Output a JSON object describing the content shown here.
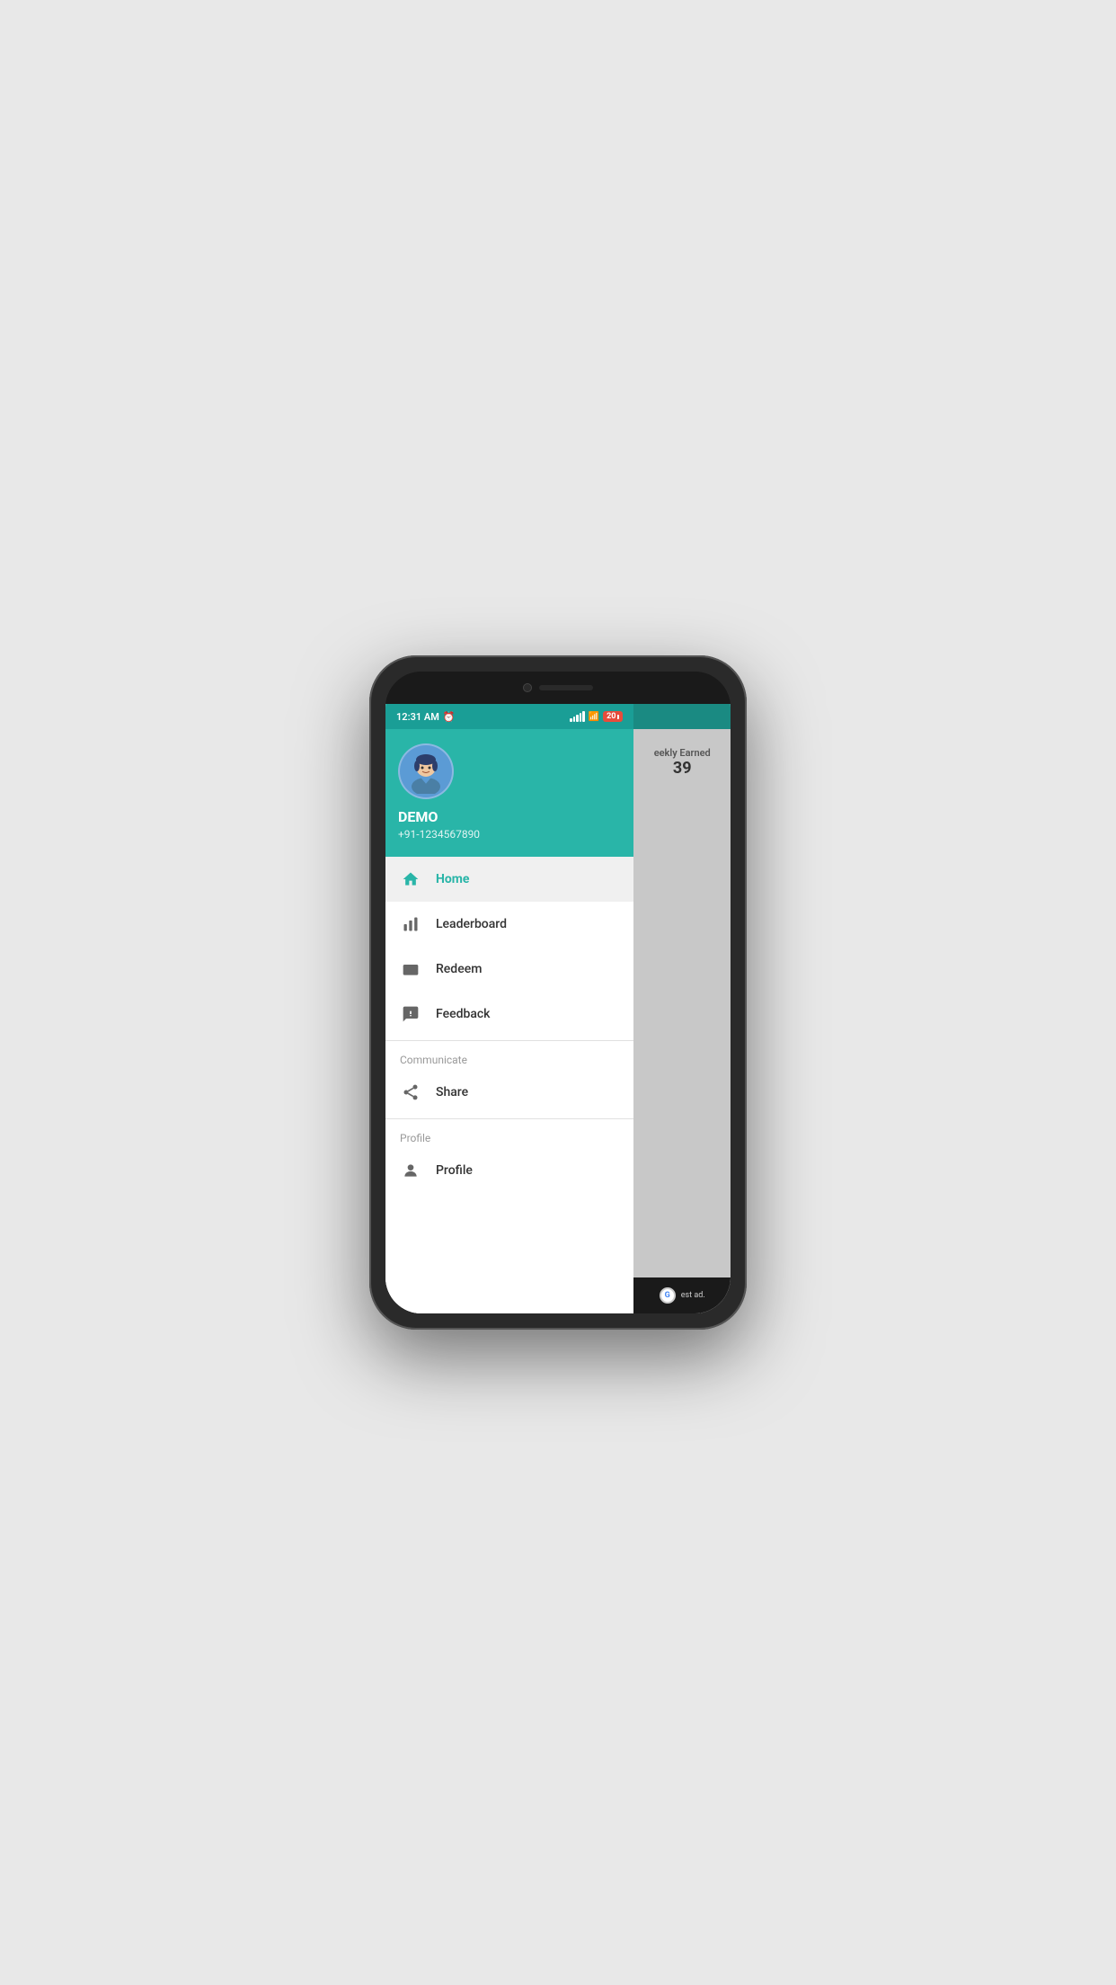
{
  "status_bar": {
    "time": "12:31 AM",
    "battery_level": "20"
  },
  "drawer_header": {
    "user_name": "DEMO",
    "user_phone": "+91-1234567890"
  },
  "menu_items": [
    {
      "id": "home",
      "label": "Home",
      "icon": "home-icon",
      "active": true
    },
    {
      "id": "leaderboard",
      "label": "Leaderboard",
      "icon": "leaderboard-icon",
      "active": false
    },
    {
      "id": "redeem",
      "label": "Redeem",
      "icon": "redeem-icon",
      "active": false
    },
    {
      "id": "feedback",
      "label": "Feedback",
      "icon": "feedback-icon",
      "active": false
    }
  ],
  "communicate_section": {
    "label": "Communicate",
    "items": [
      {
        "id": "share",
        "label": "Share",
        "icon": "share-icon"
      }
    ]
  },
  "profile_section": {
    "label": "Profile",
    "items": [
      {
        "id": "profile",
        "label": "Profile",
        "icon": "profile-icon"
      }
    ]
  },
  "main_peek": {
    "weekly_label": "eekly Earned",
    "weekly_value": "39",
    "ad_text": "est ad."
  }
}
